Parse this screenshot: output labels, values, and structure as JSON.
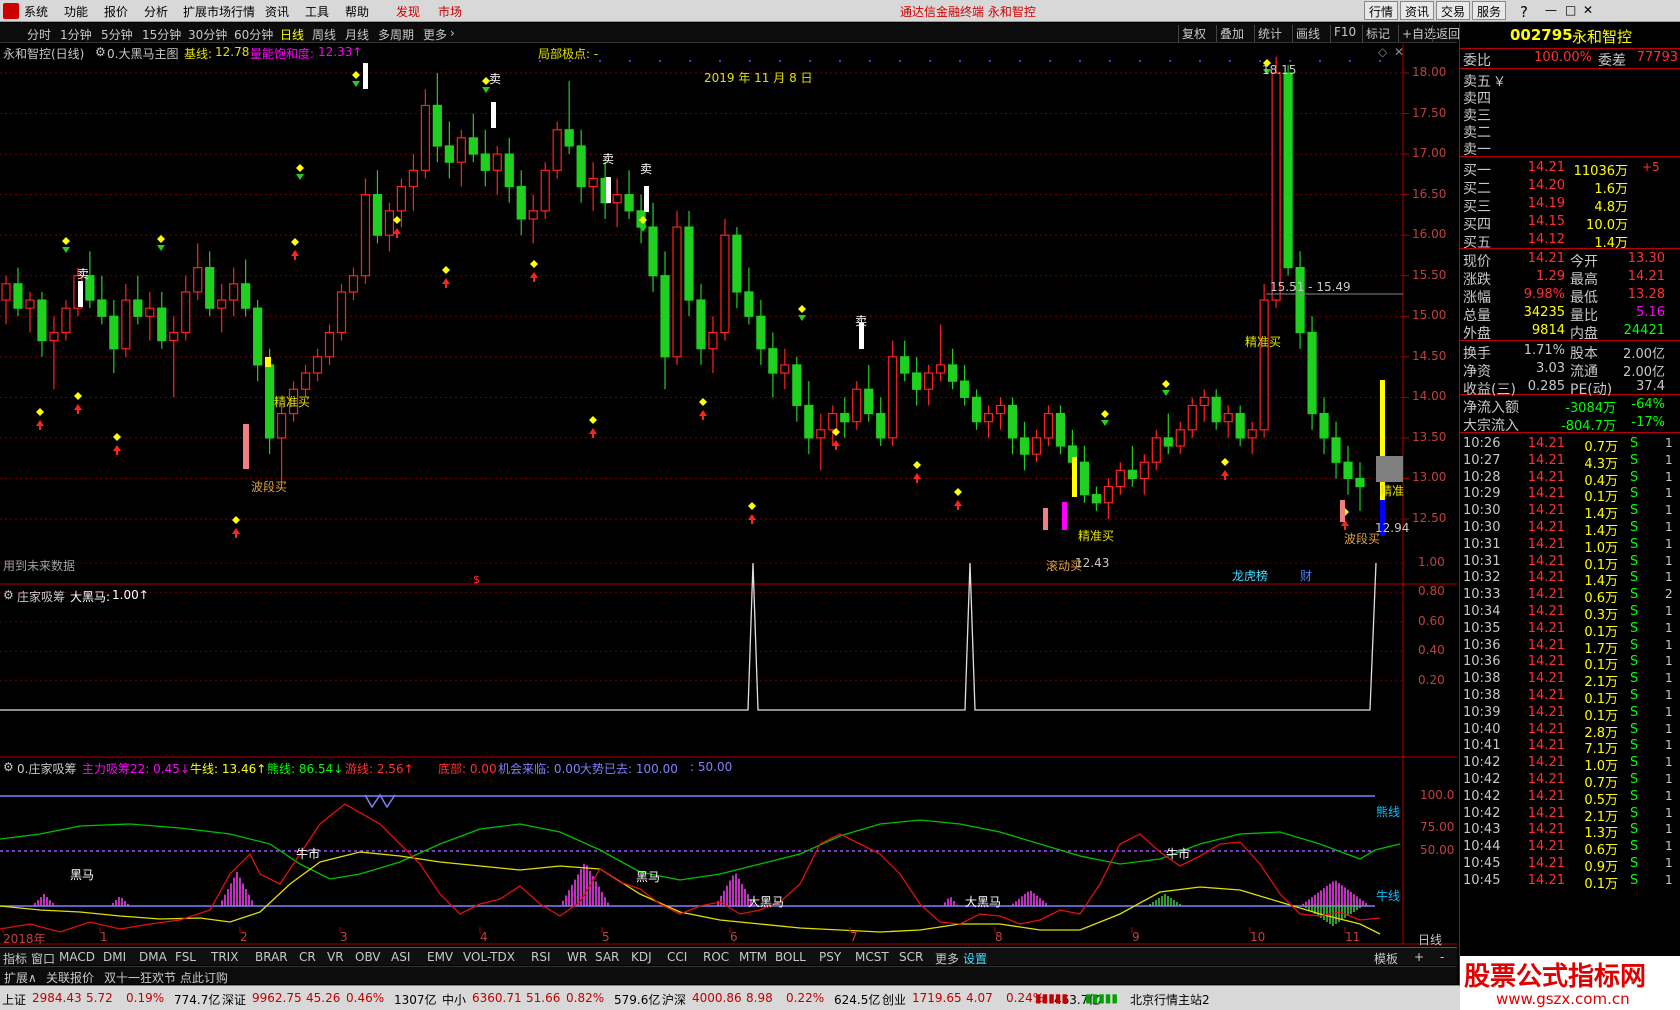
{
  "menu": {
    "items": [
      "系统",
      "功能",
      "报价",
      "分析",
      "扩展市场行情",
      "资讯",
      "工具",
      "帮助",
      "发现",
      "市场"
    ],
    "center_title": "通达信金融终端 永和智控",
    "right_buttons": [
      "行情",
      "资讯",
      "交易",
      "服务"
    ]
  },
  "periods": {
    "items": [
      "分时",
      "1分钟",
      "5分钟",
      "15分钟",
      "30分钟",
      "60分钟",
      "日线",
      "周线",
      "月线",
      "多周期",
      "更多"
    ],
    "active": "日线"
  },
  "toolbar": {
    "buttons": [
      "复权",
      "叠加",
      "统计",
      "画线",
      "F10",
      "标记",
      "+自选",
      "返回"
    ]
  },
  "main_chart": {
    "title": "永和智控(日线)",
    "indicator": "0.大黑马主图",
    "base_line_label": "基线:",
    "base_line_value": "12.78",
    "energy_label": "量能饱和度:",
    "energy_value": "12.33↑",
    "local_point_label": "局部极点: -",
    "date_label": "2019 年 11 月 8 日",
    "high_label": "18.15",
    "range_label": "15.51 - 15.49",
    "low_label1": "12.43",
    "low_label2": "12.94",
    "future_note": "用到未来数据",
    "y_ticks": [
      "18.00",
      "17.50",
      "17.00",
      "16.50",
      "16.00",
      "15.50",
      "15.00",
      "14.50",
      "14.00",
      "13.50",
      "13.00",
      "12.50"
    ],
    "annotations": {
      "sell": "卖",
      "precise_buy": "精准买",
      "wave_buy": "波段买",
      "stop_buy": "滚动买",
      "cai": "财",
      "lhb": "龙虎榜",
      "precise_right": "精准"
    },
    "candles": [
      [
        15.2,
        15.5,
        14.9,
        15.4
      ],
      [
        15.4,
        15.6,
        15.0,
        15.1
      ],
      [
        15.1,
        15.3,
        14.8,
        15.2
      ],
      [
        15.2,
        15.3,
        14.5,
        14.7
      ],
      [
        14.7,
        15.0,
        14.1,
        14.8
      ],
      [
        14.8,
        15.2,
        14.7,
        15.1
      ],
      [
        15.1,
        15.6,
        15.0,
        15.5
      ],
      [
        15.5,
        15.8,
        15.1,
        15.2
      ],
      [
        15.2,
        15.5,
        14.9,
        15.0
      ],
      [
        15.0,
        15.2,
        14.3,
        14.6
      ],
      [
        14.6,
        15.4,
        14.5,
        15.2
      ],
      [
        15.2,
        15.5,
        14.9,
        15.0
      ],
      [
        15.0,
        15.3,
        14.7,
        15.1
      ],
      [
        15.1,
        15.3,
        14.6,
        14.7
      ],
      [
        14.7,
        15.0,
        14.0,
        14.8
      ],
      [
        14.8,
        15.5,
        14.7,
        15.3
      ],
      [
        15.3,
        15.9,
        15.2,
        15.6
      ],
      [
        15.6,
        15.8,
        15.0,
        15.1
      ],
      [
        15.1,
        15.4,
        14.8,
        15.2
      ],
      [
        15.2,
        15.6,
        15.0,
        15.4
      ],
      [
        15.4,
        15.7,
        15.0,
        15.1
      ],
      [
        15.1,
        15.2,
        14.2,
        14.4
      ],
      [
        14.4,
        14.6,
        13.3,
        13.5
      ],
      [
        13.5,
        13.9,
        12.9,
        13.8
      ],
      [
        13.8,
        14.2,
        13.7,
        14.1
      ],
      [
        14.1,
        14.4,
        14.0,
        14.3
      ],
      [
        14.3,
        14.6,
        14.2,
        14.5
      ],
      [
        14.5,
        14.9,
        14.4,
        14.8
      ],
      [
        14.8,
        15.4,
        14.7,
        15.3
      ],
      [
        15.3,
        15.6,
        15.2,
        15.5
      ],
      [
        15.5,
        16.7,
        15.4,
        16.5
      ],
      [
        16.5,
        16.8,
        15.9,
        16.0
      ],
      [
        16.0,
        16.4,
        15.8,
        16.3
      ],
      [
        16.3,
        16.7,
        16.1,
        16.6
      ],
      [
        16.6,
        17.0,
        16.3,
        16.8
      ],
      [
        16.8,
        17.8,
        16.7,
        17.6
      ],
      [
        17.6,
        18.0,
        16.9,
        17.1
      ],
      [
        17.1,
        17.4,
        16.7,
        16.9
      ],
      [
        16.9,
        17.3,
        16.6,
        17.2
      ],
      [
        17.2,
        17.5,
        16.9,
        17.0
      ],
      [
        17.0,
        17.3,
        16.6,
        16.8
      ],
      [
        16.8,
        17.1,
        16.5,
        17.0
      ],
      [
        17.0,
        17.2,
        16.4,
        16.6
      ],
      [
        16.6,
        16.8,
        16.0,
        16.2
      ],
      [
        16.2,
        16.5,
        15.9,
        16.3
      ],
      [
        16.3,
        16.9,
        16.2,
        16.8
      ],
      [
        16.8,
        17.4,
        16.7,
        17.3
      ],
      [
        17.3,
        17.9,
        17.0,
        17.1
      ],
      [
        17.1,
        17.3,
        16.4,
        16.6
      ],
      [
        16.6,
        16.9,
        16.3,
        16.7
      ],
      [
        16.7,
        16.9,
        16.2,
        16.4
      ],
      [
        16.4,
        16.7,
        16.1,
        16.5
      ],
      [
        16.5,
        16.8,
        16.2,
        16.3
      ],
      [
        16.3,
        16.5,
        15.9,
        16.1
      ],
      [
        16.1,
        16.4,
        15.3,
        15.5
      ],
      [
        15.5,
        15.8,
        14.1,
        14.5
      ],
      [
        14.5,
        16.3,
        14.4,
        16.1
      ],
      [
        16.1,
        16.3,
        15.0,
        15.2
      ],
      [
        15.2,
        15.4,
        14.4,
        14.6
      ],
      [
        14.6,
        15.0,
        14.3,
        14.8
      ],
      [
        14.8,
        16.2,
        14.7,
        16.0
      ],
      [
        16.0,
        16.1,
        15.1,
        15.3
      ],
      [
        15.3,
        15.6,
        14.9,
        15.0
      ],
      [
        15.0,
        15.2,
        14.4,
        14.6
      ],
      [
        14.6,
        14.8,
        14.0,
        14.3
      ],
      [
        14.3,
        14.6,
        14.1,
        14.4
      ],
      [
        14.4,
        14.5,
        13.7,
        13.9
      ],
      [
        13.9,
        14.2,
        13.3,
        13.5
      ],
      [
        13.5,
        13.8,
        13.1,
        13.6
      ],
      [
        13.6,
        13.9,
        13.4,
        13.8
      ],
      [
        13.8,
        14.0,
        13.5,
        13.7
      ],
      [
        13.7,
        14.2,
        13.6,
        14.1
      ],
      [
        14.1,
        14.4,
        13.7,
        13.8
      ],
      [
        13.8,
        14.0,
        13.4,
        13.5
      ],
      [
        13.5,
        14.7,
        13.4,
        14.5
      ],
      [
        14.5,
        14.7,
        14.2,
        14.3
      ],
      [
        14.3,
        14.5,
        13.9,
        14.1
      ],
      [
        14.1,
        14.4,
        13.9,
        14.3
      ],
      [
        14.3,
        14.9,
        14.2,
        14.4
      ],
      [
        14.4,
        14.6,
        14.1,
        14.2
      ],
      [
        14.2,
        14.4,
        13.9,
        14.0
      ],
      [
        14.0,
        14.1,
        13.6,
        13.7
      ],
      [
        13.7,
        13.9,
        13.5,
        13.8
      ],
      [
        13.8,
        14.0,
        13.6,
        13.9
      ],
      [
        13.9,
        14.0,
        13.3,
        13.5
      ],
      [
        13.5,
        13.7,
        13.1,
        13.3
      ],
      [
        13.3,
        13.6,
        13.2,
        13.5
      ],
      [
        13.5,
        13.9,
        13.4,
        13.8
      ],
      [
        13.8,
        13.9,
        13.3,
        13.4
      ],
      [
        13.4,
        13.6,
        13.1,
        13.2
      ],
      [
        13.2,
        13.4,
        12.7,
        12.8
      ],
      [
        12.8,
        12.9,
        12.6,
        12.7
      ],
      [
        12.7,
        13.0,
        12.5,
        12.9
      ],
      [
        12.9,
        13.2,
        12.8,
        13.1
      ],
      [
        13.1,
        13.4,
        12.9,
        13.0
      ],
      [
        13.0,
        13.3,
        12.8,
        13.2
      ],
      [
        13.2,
        13.6,
        13.1,
        13.5
      ],
      [
        13.5,
        13.8,
        13.3,
        13.4
      ],
      [
        13.4,
        13.7,
        13.3,
        13.6
      ],
      [
        13.6,
        14.0,
        13.5,
        13.9
      ],
      [
        13.9,
        14.1,
        13.7,
        14.0
      ],
      [
        14.0,
        14.1,
        13.6,
        13.7
      ],
      [
        13.7,
        13.9,
        13.5,
        13.8
      ],
      [
        13.8,
        13.9,
        13.4,
        13.5
      ],
      [
        13.5,
        13.7,
        13.3,
        13.6
      ],
      [
        13.6,
        15.4,
        13.5,
        15.2
      ],
      [
        15.2,
        18.2,
        15.1,
        18.0
      ],
      [
        18.0,
        18.1,
        15.5,
        15.6
      ],
      [
        15.6,
        15.8,
        14.6,
        14.8
      ],
      [
        14.8,
        15.0,
        13.6,
        13.8
      ],
      [
        13.8,
        14.0,
        13.3,
        13.5
      ],
      [
        13.5,
        13.7,
        13.0,
        13.2
      ],
      [
        13.2,
        13.4,
        12.8,
        13.0
      ],
      [
        13.0,
        13.2,
        12.6,
        12.9
      ]
    ]
  },
  "sub_chart1": {
    "title": "庄家吸筹",
    "series_label": "大黑马:",
    "series_value": "1.00↑",
    "y_ticks": [
      "1.00",
      "0.80",
      "0.60",
      "0.40",
      "0.20"
    ]
  },
  "sub_chart2": {
    "title": "0.庄家吸筹",
    "labels": [
      {
        "text": "主力吸筹22: 0.45↓",
        "color": "#ff00ff"
      },
      {
        "text": "牛线: 13.46↑",
        "color": "#ffff00"
      },
      {
        "text": "熊线: 86.54↓",
        "color": "#00ff00"
      },
      {
        "text": "游线: 2.56↑",
        "color": "#ff3030"
      },
      {
        "text": "底部: 0.00",
        "color": "#ff3030"
      },
      {
        "text": "机会来临: 0.00",
        "color": "#8080ff"
      },
      {
        "text": "大势已去: 100.00",
        "color": "#8080ff"
      },
      {
        "text": ": 50.00",
        "color": "#8080ff"
      }
    ],
    "y_ticks": [
      "100.0",
      "75.00",
      "50.00"
    ],
    "chart_labels": {
      "heima": "黑马",
      "niushi": "牛市",
      "dheima": "大黑马",
      "xiongxian": "熊线",
      "niuxian": "牛线"
    }
  },
  "time_axis": {
    "labels": [
      "2018年",
      "1",
      "2",
      "3",
      "4",
      "5",
      "6",
      "7",
      "8",
      "9",
      "10",
      "11"
    ],
    "right_label": "日线"
  },
  "indicator_tabs": [
    "指标",
    "窗口",
    "MACD",
    "DMI",
    "DMA",
    "FSL",
    "TRIX",
    "BRAR",
    "CR",
    "VR",
    "OBV",
    "ASI",
    "EMV",
    "VOL-TDX",
    "RSI",
    "WR",
    "SAR",
    "KDJ",
    "CCI",
    "ROC",
    "MTM",
    "BOLL",
    "PSY",
    "MCST",
    "SCR",
    "更多",
    "设置"
  ],
  "tabs_right": [
    "模板",
    "+",
    "-"
  ],
  "ext_bar": [
    "扩展∧",
    "关联报价",
    "双十一狂欢节 点此订购"
  ],
  "quote_panel": {
    "code": "002795",
    "name": "永和智控",
    "weibi_label": "委比",
    "weibi_value": "100.00%",
    "weicha_label": "委差",
    "weicha_value": "77793",
    "sell_rows": [
      {
        "label": "卖五",
        "price": "￥"
      },
      {
        "label": "卖四",
        "price": ""
      },
      {
        "label": "卖三",
        "price": ""
      },
      {
        "label": "卖二",
        "price": ""
      },
      {
        "label": "卖一",
        "price": ""
      }
    ],
    "buy_rows": [
      {
        "label": "买一",
        "price": "14.21",
        "vol": "11036万",
        "chg": "+5"
      },
      {
        "label": "买二",
        "price": "14.20",
        "vol": "1.6万",
        "chg": ""
      },
      {
        "label": "买三",
        "price": "14.19",
        "vol": "4.8万",
        "chg": ""
      },
      {
        "label": "买四",
        "price": "14.15",
        "vol": "10.0万",
        "chg": ""
      },
      {
        "label": "买五",
        "price": "14.12",
        "vol": "1.4万",
        "chg": ""
      }
    ],
    "stats": [
      {
        "l1": "现价",
        "v1": "14.21",
        "l2": "今开",
        "v2": "13.30",
        "c2": "#ff3030"
      },
      {
        "l1": "涨跌",
        "v1": "1.29",
        "l2": "最高",
        "v2": "14.21",
        "c2": "#ff3030"
      },
      {
        "l1": "涨幅",
        "v1": "9.98%",
        "l2": "最低",
        "v2": "13.28",
        "c2": "#ff3030"
      },
      {
        "l1": "总量",
        "v1": "34235",
        "l2": "量比",
        "v2": "5.16",
        "c2": "#ff00ff"
      },
      {
        "l1": "外盘",
        "v1": "9814",
        "l2": "内盘",
        "v2": "24421",
        "c2": "#00ff00"
      }
    ],
    "stats2": [
      {
        "l1": "换手",
        "v1": "1.71%",
        "l2": "股本",
        "v2": "2.00亿"
      },
      {
        "l1": "净资",
        "v1": "3.03",
        "l2": "流通",
        "v2": "2.00亿"
      },
      {
        "l1": "收益(三)",
        "v1": "0.285",
        "l2": "PE(动)",
        "v2": "37.4"
      }
    ],
    "flow": [
      {
        "label": "净流入额",
        "v1": "-3084万",
        "v2": "-64%"
      },
      {
        "label": "大宗流入",
        "v1": "-804.7万",
        "v2": "-17%"
      }
    ],
    "ticks": [
      [
        "10:26",
        "14.21",
        "0.7万",
        "S",
        "1"
      ],
      [
        "10:27",
        "14.21",
        "4.3万",
        "S",
        "1"
      ],
      [
        "10:28",
        "14.21",
        "0.4万",
        "S",
        "1"
      ],
      [
        "10:29",
        "14.21",
        "0.1万",
        "S",
        "1"
      ],
      [
        "10:30",
        "14.21",
        "1.4万",
        "S",
        "1"
      ],
      [
        "10:30",
        "14.21",
        "1.4万",
        "S",
        "1"
      ],
      [
        "10:31",
        "14.21",
        "1.0万",
        "S",
        "1"
      ],
      [
        "10:31",
        "14.21",
        "0.1万",
        "S",
        "1"
      ],
      [
        "10:32",
        "14.21",
        "1.4万",
        "S",
        "1"
      ],
      [
        "10:33",
        "14.21",
        "0.6万",
        "S",
        "2"
      ],
      [
        "10:34",
        "14.21",
        "0.3万",
        "S",
        "1"
      ],
      [
        "10:35",
        "14.21",
        "0.1万",
        "S",
        "1"
      ],
      [
        "10:36",
        "14.21",
        "1.7万",
        "S",
        "1"
      ],
      [
        "10:36",
        "14.21",
        "0.1万",
        "S",
        "1"
      ],
      [
        "10:38",
        "14.21",
        "2.1万",
        "S",
        "1"
      ],
      [
        "10:38",
        "14.21",
        "0.1万",
        "S",
        "1"
      ],
      [
        "10:39",
        "14.21",
        "0.1万",
        "S",
        "1"
      ],
      [
        "10:40",
        "14.21",
        "2.8万",
        "S",
        "1"
      ],
      [
        "10:41",
        "14.21",
        "7.1万",
        "S",
        "1"
      ],
      [
        "10:42",
        "14.21",
        "1.0万",
        "S",
        "1"
      ],
      [
        "10:42",
        "14.21",
        "0.7万",
        "S",
        "1"
      ],
      [
        "10:42",
        "14.21",
        "0.5万",
        "S",
        "1"
      ],
      [
        "10:42",
        "14.21",
        "2.1万",
        "S",
        "1"
      ],
      [
        "10:43",
        "14.21",
        "1.3万",
        "S",
        "1"
      ],
      [
        "10:44",
        "14.21",
        "0.6万",
        "S",
        "1"
      ],
      [
        "10:45",
        "14.21",
        "0.9万",
        "S",
        "1"
      ],
      [
        "10:45",
        "14.21",
        "0.1万",
        "S",
        "1"
      ]
    ]
  },
  "status_bar": {
    "items": [
      {
        "name": "上证",
        "price": "2984.43",
        "chg": "5.72",
        "pct": "0.19%",
        "amt": "774.7亿"
      },
      {
        "name": "深证",
        "price": "9962.75",
        "chg": "45.26",
        "pct": "0.46%",
        "amt": "1307亿"
      },
      {
        "name": "中小",
        "price": "6360.71",
        "chg": "51.66",
        "pct": "0.82%",
        "amt": "579.6亿"
      },
      {
        "name": "沪深",
        "price": "4000.86",
        "chg": "8.98",
        "pct": "0.22%",
        "amt": "624.5亿"
      },
      {
        "name": "创业",
        "price": "1719.65",
        "chg": "4.07",
        "pct": "0.24%",
        "amt": "463.7亿"
      }
    ],
    "server": "北京行情主站2"
  },
  "brand": {
    "title": "股票公式指标网",
    "url": "www.gszx.com.cn"
  }
}
